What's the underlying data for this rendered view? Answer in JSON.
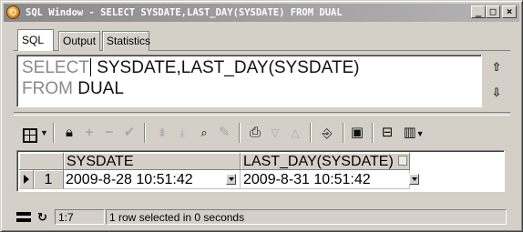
{
  "window": {
    "title": "SQL Window - SELECT SYSDATE,LAST_DAY(SYSDATE) FROM DUAL",
    "controls": {
      "minimize": "_",
      "maximize": "□",
      "close": "×"
    }
  },
  "tabs": [
    {
      "label": "SQL",
      "active": true
    },
    {
      "label": "Output",
      "active": false
    },
    {
      "label": "Statistics",
      "active": false
    }
  ],
  "editor": {
    "line1_keyword": "SELECT",
    "line1_rest": " SYSDATE,LAST_DAY(SYSDATE)",
    "line2_keyword": "FROM",
    "line2_rest": " DUAL"
  },
  "toolbar": {
    "icons": [
      "grid-view-icon",
      "lock-icon",
      "insert-record-icon",
      "delete-record-icon",
      "post-changes-icon",
      "next-page-icon",
      "last-page-icon",
      "query-by-example-icon",
      "clear-record-icon",
      "export-results-icon",
      "sort-down-icon",
      "sort-up-icon",
      "connect-icon",
      "save-icon",
      "print-icon",
      "chart-icon"
    ]
  },
  "grid": {
    "columns": [
      "SYSDATE",
      "LAST_DAY(SYSDATE)"
    ],
    "rows": [
      {
        "num": "1",
        "cells": [
          "2009-8-28 10:51:42",
          "2009-8-31 10:51:42"
        ]
      }
    ]
  },
  "statusbar": {
    "position": "1:7",
    "message": "1 row selected in 0 seconds"
  },
  "colors": {
    "face": "#d4d0c8",
    "title_gradient_start": "#8a8a8a",
    "title_gradient_end": "#b4b4b4",
    "keyword": "#8a8a8a"
  }
}
